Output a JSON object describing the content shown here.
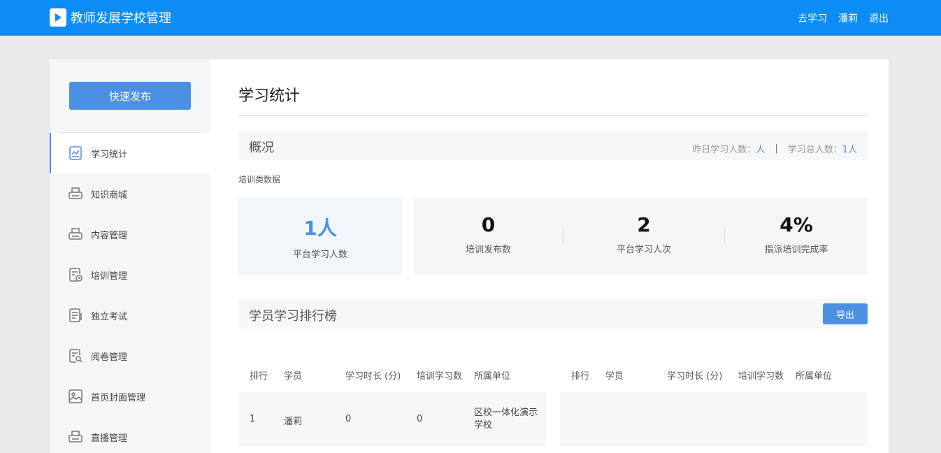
{
  "header": {
    "title": "教师发展学校管理",
    "nav": [
      "去学习",
      "潘莉",
      "退出"
    ]
  },
  "sidebar": {
    "quick_publish": "快速发布",
    "items": [
      {
        "label": "学习统计",
        "icon": "chart-doc-icon",
        "active": true
      },
      {
        "label": "知识商城",
        "icon": "printer-icon",
        "active": false
      },
      {
        "label": "内容管理",
        "icon": "printer-icon",
        "active": false
      },
      {
        "label": "培训管理",
        "icon": "doc-clock-icon",
        "active": false
      },
      {
        "label": "独立考试",
        "icon": "doc-list-icon",
        "active": false
      },
      {
        "label": "阅卷管理",
        "icon": "doc-search-icon",
        "active": false
      },
      {
        "label": "首页封面管理",
        "icon": "image-icon",
        "active": false
      },
      {
        "label": "直播管理",
        "icon": "printer-icon",
        "active": false
      }
    ]
  },
  "main": {
    "page_title": "学习统计",
    "overview": {
      "title": "概况",
      "yesterday_label": "昨日学习人数：",
      "yesterday_value": "人",
      "separator": "|",
      "total_label": "学习总人数：",
      "total_value": "1人"
    },
    "training_subhead": "培训类数据",
    "cards": [
      {
        "value": "1人",
        "label": "平台学习人数"
      },
      {
        "value": "0",
        "label": "培训发布数"
      },
      {
        "value": "2",
        "label": "平台学习人次"
      },
      {
        "value": "4%",
        "label": "指派培训完成率"
      }
    ],
    "ranking": {
      "title": "学员学习排行榜",
      "export_label": "导出",
      "columns": [
        "排行",
        "学员",
        "学习时长 (分)",
        "培训学习数",
        "所属单位"
      ],
      "left_rows": [
        {
          "rank": "1",
          "name": "潘莉",
          "minutes": "0",
          "count": "0",
          "unit": "区校一体化演示学校"
        }
      ]
    }
  },
  "colors": {
    "topbar": "#0c8cf5",
    "accent": "#4b90e2"
  }
}
